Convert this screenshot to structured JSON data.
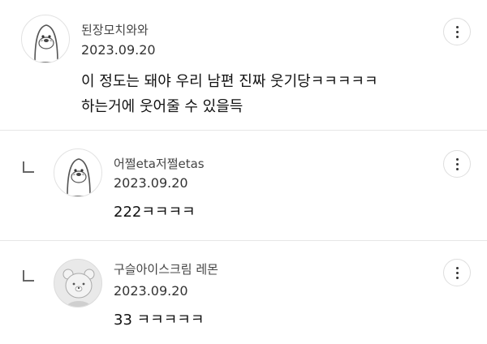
{
  "comments": [
    {
      "username": "된장모치와와",
      "date": "2023.09.20",
      "lines": [
        "이 정도는 돼야 우리 남편 진짜 웃기당ㅋㅋㅋㅋㅋ",
        "하는거에 웃어줄 수 있을득"
      ],
      "avatar_icon": "penguin-avatar-icon",
      "more_icon": "more-vertical-icon"
    },
    {
      "username": "어쩔eta저쩔etas",
      "date": "2023.09.20",
      "lines": [
        "222ㅋㅋㅋㅋ"
      ],
      "is_reply": true,
      "avatar_icon": "penguin-avatar-icon",
      "reply_icon": "reply-arrow-icon",
      "more_icon": "more-vertical-icon"
    },
    {
      "username": "구슬아이스크림 레몬",
      "date": "2023.09.20",
      "lines": [
        "33 ㅋㅋㅋㅋㅋ"
      ],
      "is_reply": true,
      "avatar_icon": "bear-avatar-icon",
      "reply_icon": "reply-arrow-icon",
      "more_icon": "more-vertical-icon"
    }
  ]
}
